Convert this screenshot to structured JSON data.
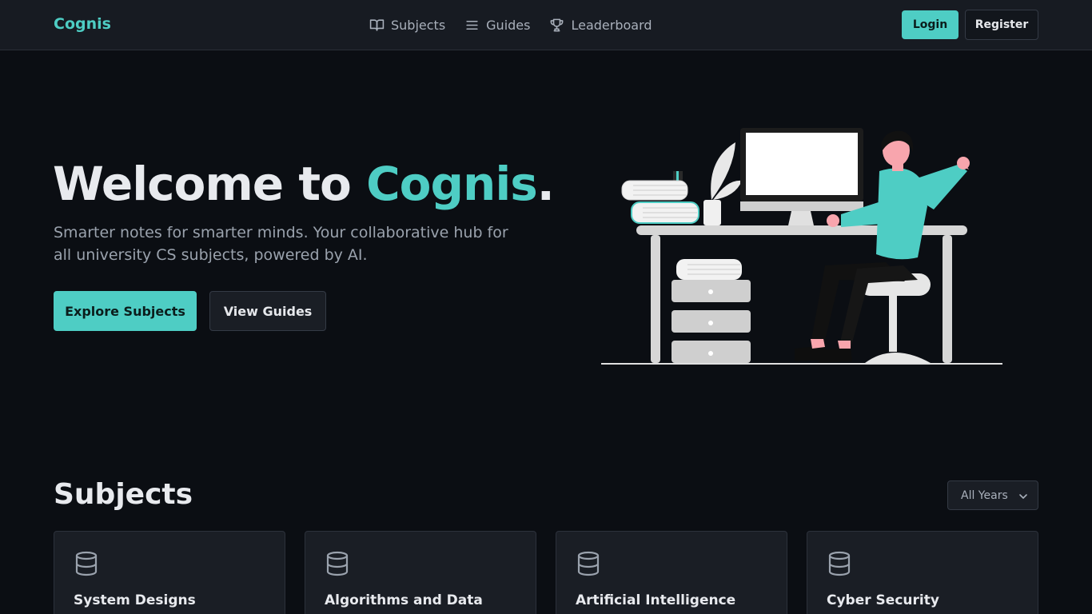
{
  "header": {
    "brand": "Cognis",
    "nav": [
      {
        "label": "Subjects",
        "icon": "book-open-icon"
      },
      {
        "label": "Guides",
        "icon": "list-icon"
      },
      {
        "label": "Leaderboard",
        "icon": "trophy-icon"
      }
    ],
    "login_label": "Login",
    "register_label": "Register"
  },
  "hero": {
    "title_prefix": "Welcome to ",
    "title_accent": "Cognis",
    "title_suffix": ".",
    "subtitle": "Smarter notes for smarter minds. Your collaborative hub for all university CS subjects, powered by AI.",
    "primary_button": "Explore Subjects",
    "secondary_button": "View Guides"
  },
  "subjects": {
    "title": "Subjects",
    "year_filter": "All Years",
    "cards": [
      {
        "title": "System Designs",
        "icon": "database-icon"
      },
      {
        "title": "Algorithms and Data",
        "icon": "database-icon"
      },
      {
        "title": "Artificial Intelligence",
        "icon": "database-icon"
      },
      {
        "title": "Cyber Security",
        "icon": "database-icon"
      }
    ]
  },
  "colors": {
    "accent": "#4ecdc4",
    "background": "#0b0e13",
    "surface": "#1a1e25"
  }
}
